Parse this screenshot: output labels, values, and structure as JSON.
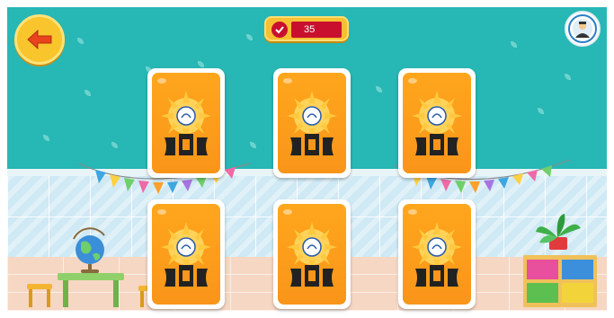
{
  "hud": {
    "back_icon": "arrow-left-icon",
    "score_icon": "checkmark-icon",
    "score_value": "35",
    "badge_icon": "school-emblem-icon"
  },
  "cards": [
    {
      "state": "face-down",
      "back_icon": "sunflower-emblem-icon"
    },
    {
      "state": "face-down",
      "back_icon": "sunflower-emblem-icon"
    },
    {
      "state": "face-down",
      "back_icon": "sunflower-emblem-icon"
    },
    {
      "state": "face-down",
      "back_icon": "sunflower-emblem-icon"
    },
    {
      "state": "face-down",
      "back_icon": "sunflower-emblem-icon"
    },
    {
      "state": "face-down",
      "back_icon": "sunflower-emblem-icon"
    }
  ],
  "colors": {
    "wall": "#27b7b5",
    "card_back": "#f9951a",
    "score_red": "#c8102e",
    "button_yellow": "#f9c52d"
  }
}
